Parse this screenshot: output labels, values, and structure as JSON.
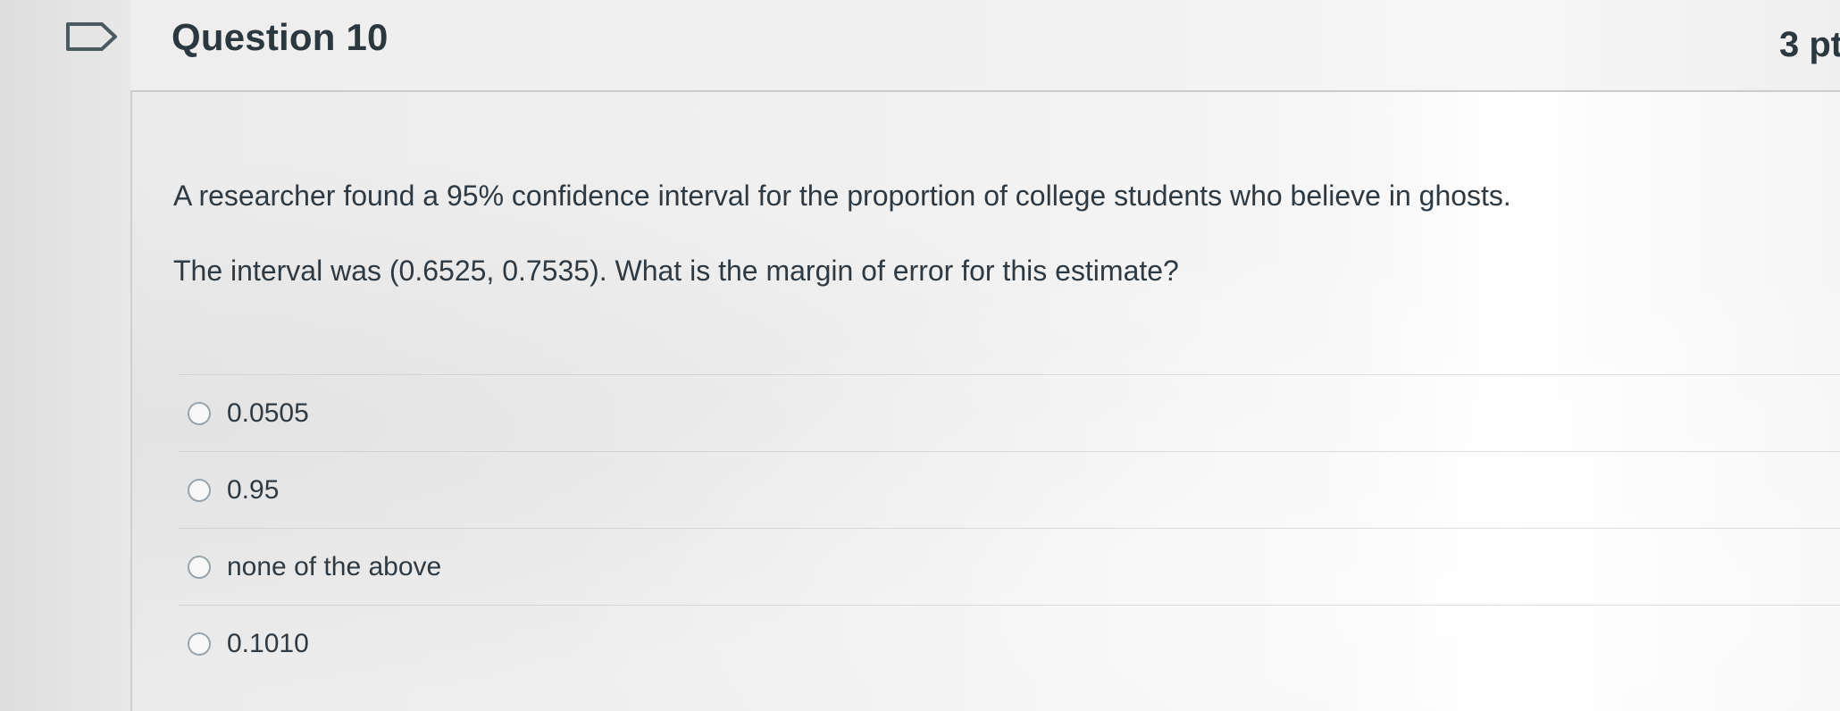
{
  "question": {
    "title": "Question 10",
    "points": "3 pt",
    "text_line_1": "A researcher found a 95% confidence interval for the proportion of college students who believe in ghosts.",
    "text_line_2": "The interval was (0.6525,  0.7535).  What is the margin of error for this estimate?"
  },
  "answers": [
    {
      "label": "0.0505"
    },
    {
      "label": "0.95"
    },
    {
      "label": "none of the above"
    },
    {
      "label": "0.1010"
    }
  ],
  "icons": {
    "flag": "flag-icon",
    "radio": "radio-button-icon"
  },
  "colors": {
    "text": "#2d3b45",
    "border": "#cbcbcb",
    "radio_border": "#9aa4aa"
  }
}
